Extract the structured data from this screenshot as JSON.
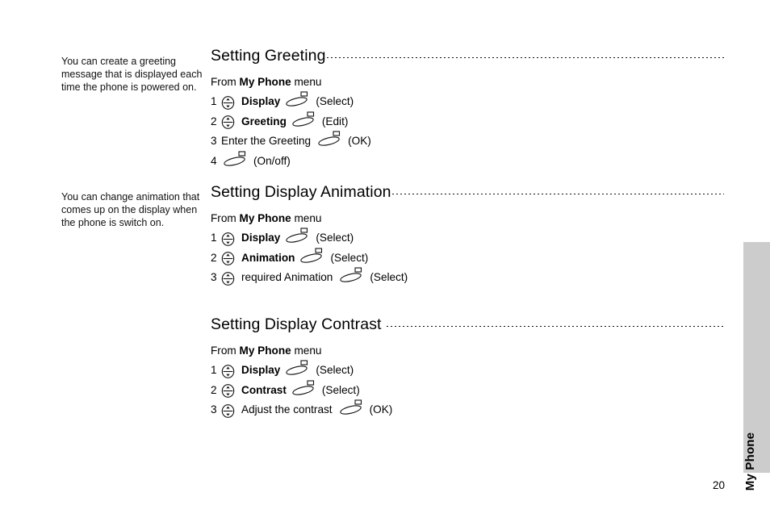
{
  "page": {
    "number": "20",
    "tab_label": "My Phone",
    "tab_color": "#cccccc"
  },
  "side_notes": [
    {
      "text": "You can create a greeting message that is displayed each time the phone is powered on."
    },
    {
      "text": "You can change animation that comes up on the display when the phone is switch on."
    }
  ],
  "sections": [
    {
      "heading": "Setting Greeting",
      "heading_gap": false,
      "from_prefix": "From ",
      "from_bold": "My Phone",
      "from_suffix": " menu",
      "steps": [
        {
          "num": "1",
          "nav_icon": "navigation-key-icon",
          "label": "Display",
          "bold": true,
          "soft_icon": "soft-key-icon",
          "action": "(Select)"
        },
        {
          "num": "2",
          "nav_icon": "navigation-key-icon",
          "label": "Greeting",
          "bold": true,
          "soft_icon": "soft-key-icon",
          "action": "(Edit)"
        },
        {
          "num": "3",
          "nav_icon": "",
          "label": "Enter the Greeting",
          "bold": false,
          "soft_icon": "soft-key-icon",
          "action": "(OK)"
        },
        {
          "num": "4",
          "nav_icon": "",
          "label": "",
          "bold": false,
          "soft_icon": "soft-key-icon",
          "action": "(On/off)"
        }
      ]
    },
    {
      "heading": "Setting Display Animation",
      "heading_gap": false,
      "from_prefix": "From ",
      "from_bold": "My Phone",
      "from_suffix": " menu",
      "steps": [
        {
          "num": "1",
          "nav_icon": "navigation-key-icon",
          "label": "Display",
          "bold": true,
          "soft_icon": "soft-key-icon",
          "action": "(Select)"
        },
        {
          "num": "2",
          "nav_icon": "navigation-key-icon",
          "label": "Animation",
          "bold": true,
          "soft_icon": "soft-key-icon",
          "action": "(Select)"
        },
        {
          "num": "3",
          "nav_icon": "navigation-key-icon",
          "label": "required Animation",
          "bold": false,
          "soft_icon": "soft-key-icon",
          "action": "(Select)"
        }
      ]
    },
    {
      "heading": "Setting Display Contrast",
      "heading_gap": true,
      "from_prefix": "From ",
      "from_bold": "My Phone",
      "from_suffix": " menu",
      "steps": [
        {
          "num": "1",
          "nav_icon": "navigation-key-icon",
          "label": "Display",
          "bold": true,
          "soft_icon": "soft-key-icon",
          "action": "(Select)"
        },
        {
          "num": "2",
          "nav_icon": "navigation-key-icon",
          "label": "Contrast",
          "bold": true,
          "soft_icon": "soft-key-icon",
          "action": "(Select)"
        },
        {
          "num": "3",
          "nav_icon": "navigation-key-icon",
          "label": "Adjust the contrast",
          "bold": false,
          "soft_icon": "soft-key-icon",
          "action": "(OK)"
        }
      ]
    }
  ]
}
